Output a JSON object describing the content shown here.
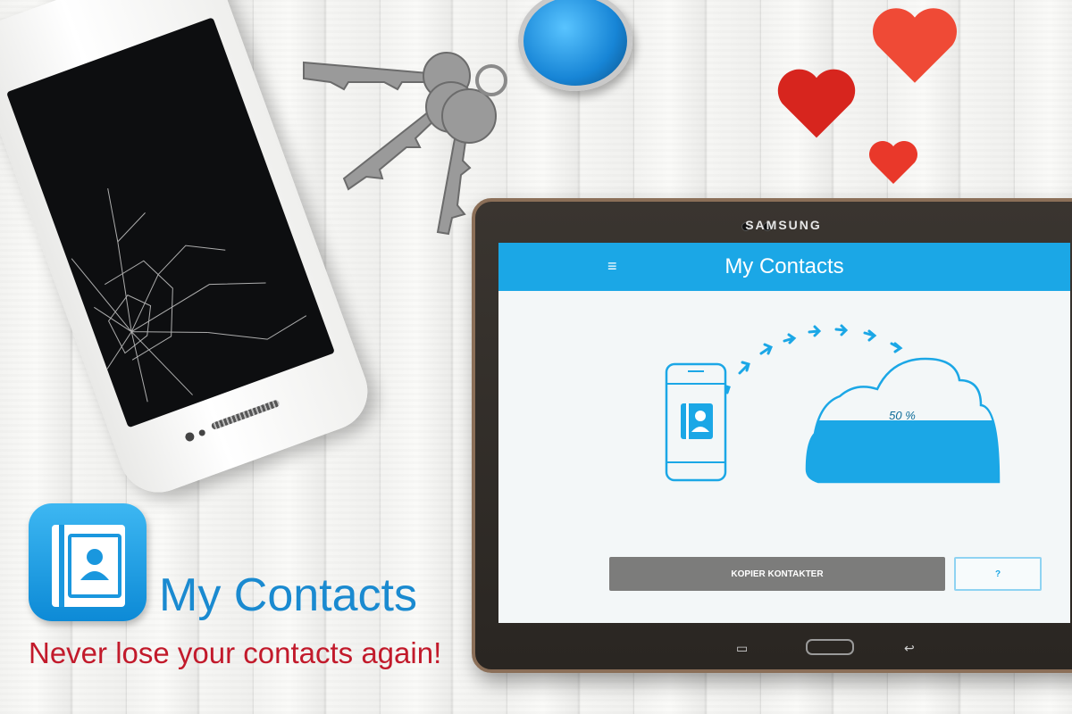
{
  "tablet": {
    "brand": "SAMSUNG"
  },
  "app": {
    "title": "My Contacts",
    "menu_icon": "hamburger-menu-icon",
    "upload_progress_label": "50 %",
    "upload_progress_fraction": 0.5,
    "copy_button_label": "KOPIER KONTAKTER",
    "help_button_label": "?"
  },
  "promo": {
    "title": "My Contacts",
    "tagline": "Never lose your contacts again!"
  },
  "colors": {
    "accent": "#1ba7e6",
    "tagline": "#c21a2b",
    "promo_title": "#1a8ad0",
    "button_gray": "#7c7c7b"
  }
}
